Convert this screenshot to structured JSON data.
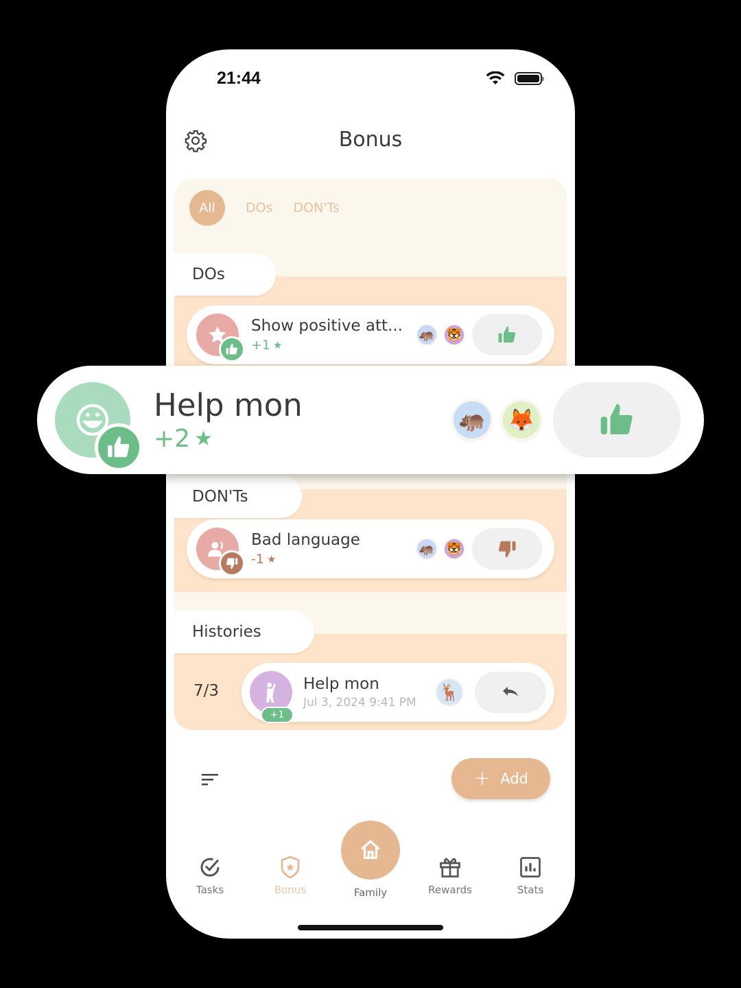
{
  "status_bar": {
    "time": "21:44"
  },
  "header": {
    "title": "Bonus",
    "settings_icon": "gear-icon"
  },
  "filter_tabs": [
    {
      "label": "All",
      "active": true
    },
    {
      "label": "DOs",
      "active": false
    },
    {
      "label": "DON'Ts",
      "active": false
    }
  ],
  "sections": {
    "dos": {
      "label": "DOs",
      "items": [
        {
          "title": "Show positive att...",
          "points": "+1",
          "icon": "star-icon",
          "badge": "thumbs-up-icon",
          "avatars": [
            "hippo-avatar",
            "tiger-avatar"
          ],
          "action": "thumbs-up-icon"
        }
      ]
    },
    "donts": {
      "label": "DON'Ts",
      "items": [
        {
          "title": "Bad language",
          "points": "-1",
          "icon": "people-icon",
          "badge": "thumbs-down-icon",
          "avatars": [
            "hippo-avatar",
            "tiger-avatar"
          ],
          "action": "thumbs-down-icon"
        }
      ]
    },
    "histories": {
      "label": "Histories",
      "items": [
        {
          "date": "7/3",
          "title": "Help mon",
          "timestamp": "Jul 3, 2024 9:41 PM",
          "points": "+1",
          "icon": "cheer-person-icon",
          "avatar": "deer-avatar",
          "action": "undo-icon"
        }
      ]
    }
  },
  "overlay_card": {
    "title": "Help mon",
    "points": "+2",
    "icon": "smile-icon",
    "badge": "thumbs-up-icon",
    "avatars": [
      "hippo-avatar",
      "fox-avatar"
    ],
    "action": "thumbs-up-icon"
  },
  "toolbar": {
    "add_label": "Add",
    "sort_icon": "sort-icon"
  },
  "bottom_nav": [
    {
      "label": "Tasks",
      "icon": "check-circle-icon",
      "active": false
    },
    {
      "label": "Bonus",
      "icon": "shield-star-icon",
      "active": true
    },
    {
      "label": "Family",
      "icon": "home-icon",
      "active": false
    },
    {
      "label": "Rewards",
      "icon": "gift-icon",
      "active": false
    },
    {
      "label": "Stats",
      "icon": "bar-chart-icon",
      "active": false
    }
  ],
  "colors": {
    "accent": "#e6b892",
    "green": "#6cbd87",
    "brown": "#b77a5d",
    "section_bg": "#fde4ca",
    "panel_bg": "#fcf7ec"
  }
}
